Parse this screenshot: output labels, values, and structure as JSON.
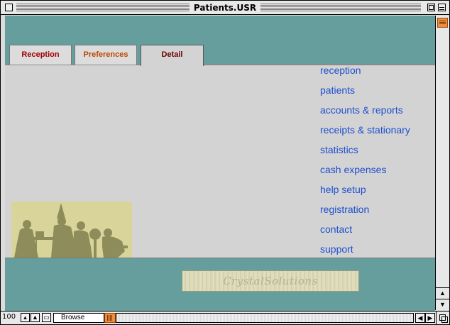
{
  "window": {
    "title": "Patients.USR"
  },
  "tabs": [
    {
      "label": "Reception",
      "active": false,
      "color": "#a00000"
    },
    {
      "label": "Preferences",
      "active": false,
      "color": "#c04400"
    },
    {
      "label": "Detail",
      "active": true,
      "color": "#6a0000"
    }
  ],
  "links": [
    {
      "label": "reception"
    },
    {
      "label": "patients"
    },
    {
      "label": "accounts & reports"
    },
    {
      "label": "receipts & stationary"
    },
    {
      "label": "statistics"
    },
    {
      "label": "cash expenses"
    },
    {
      "label": "help setup"
    },
    {
      "label": "registration"
    },
    {
      "label": "contact"
    },
    {
      "label": "support"
    }
  ],
  "logo": {
    "text": "CrystalSolutions"
  },
  "statusbar": {
    "zoom": "100",
    "mode": "Browse"
  },
  "colors": {
    "teal_band": "#669e9e",
    "content_bg": "#d3d3d3",
    "link": "#1e4fcf",
    "scroll_thumb": "#f08c3c"
  }
}
